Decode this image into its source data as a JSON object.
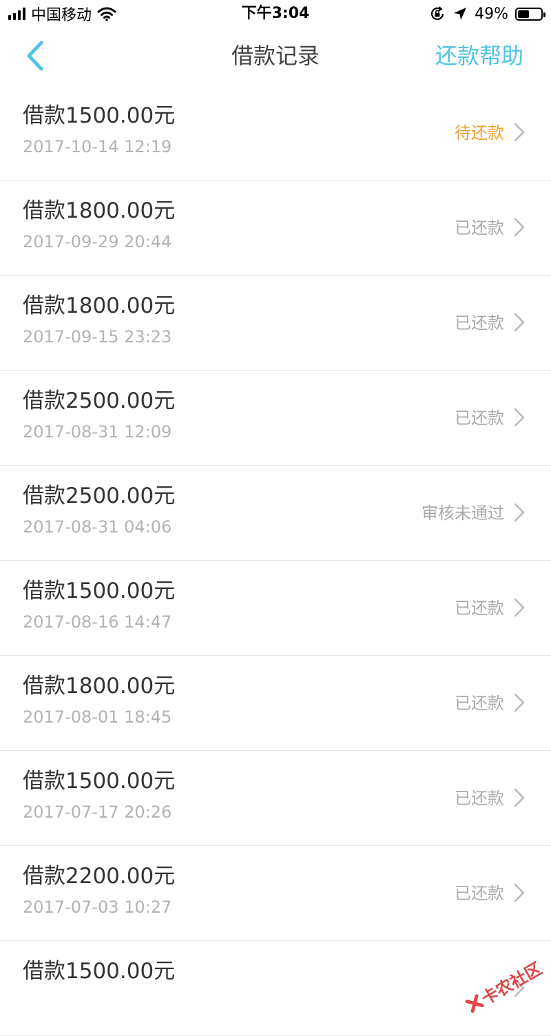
{
  "status_bar": {
    "carrier": "中国移动",
    "time": "下午3:04",
    "battery_percent": "49%",
    "battery_level": 0.49
  },
  "nav": {
    "title": "借款记录",
    "action_label": "还款帮助",
    "back_icon": "chevron-left-icon"
  },
  "loans": [
    {
      "amount": "借款1500.00元",
      "date": "2017-10-14 12:19",
      "status": "待还款",
      "status_type": "pending"
    },
    {
      "amount": "借款1800.00元",
      "date": "2017-09-29 20:44",
      "status": "已还款",
      "status_type": "repaid"
    },
    {
      "amount": "借款1800.00元",
      "date": "2017-09-15 23:23",
      "status": "已还款",
      "status_type": "repaid"
    },
    {
      "amount": "借款2500.00元",
      "date": "2017-08-31 12:09",
      "status": "已还款",
      "status_type": "repaid"
    },
    {
      "amount": "借款2500.00元",
      "date": "2017-08-31 04:06",
      "status": "审核未通过",
      "status_type": "rejected"
    },
    {
      "amount": "借款1500.00元",
      "date": "2017-08-16 14:47",
      "status": "已还款",
      "status_type": "repaid"
    },
    {
      "amount": "借款1800.00元",
      "date": "2017-08-01 18:45",
      "status": "已还款",
      "status_type": "repaid"
    },
    {
      "amount": "借款1500.00元",
      "date": "2017-07-17 20:26",
      "status": "已还款",
      "status_type": "repaid"
    },
    {
      "amount": "借款2200.00元",
      "date": "2017-07-03 10:27",
      "status": "已还款",
      "status_type": "repaid"
    },
    {
      "amount": "借款1500.00元",
      "date": "",
      "status": "",
      "status_type": "repaid"
    }
  ],
  "colors": {
    "accent": "#4FC3E8",
    "pending": "#F0A030",
    "muted": "#AAAAAA",
    "watermark": "#D62828"
  },
  "watermark": {
    "text": "卡农社区"
  }
}
